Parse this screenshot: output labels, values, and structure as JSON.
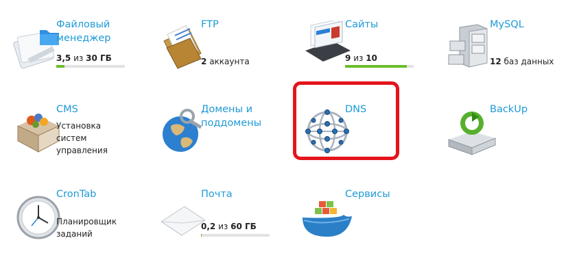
{
  "tiles": {
    "files": {
      "title_line1": "Файловый",
      "title_line2": "менеджер",
      "used": "3,5",
      "sep": "из",
      "total": "30 ГБ",
      "usage_fraction": 0.117,
      "icon": "file-manager-icon"
    },
    "ftp": {
      "title": "FTP",
      "count": "2",
      "count_label": "аккаунта",
      "icon": "ftp-folder-icon"
    },
    "sites": {
      "title": "Сайты",
      "used": "9",
      "sep": "из",
      "total": "10",
      "usage_fraction": 0.9,
      "icon": "websites-icon"
    },
    "mysql": {
      "title": "MySQL",
      "count": "12",
      "count_label": "баз данных",
      "icon": "database-cabinet-icon"
    },
    "cms": {
      "title": "CMS",
      "desc_line1": "Установка",
      "desc_line2": "систем",
      "desc_line3": "управления",
      "icon": "cms-box-icon"
    },
    "domains": {
      "title_line1": "Домены и",
      "title_line2": "поддомены",
      "icon": "globe-keys-icon"
    },
    "dns": {
      "title": "DNS",
      "icon": "dns-network-sphere-icon",
      "highlighted": true,
      "highlight_color": "#e5141b"
    },
    "backup": {
      "title": "BackUp",
      "icon": "backup-drive-icon"
    },
    "cron": {
      "title": "CronTab",
      "desc_line1": "Планировщик",
      "desc_line2": "заданий",
      "icon": "clock-icon"
    },
    "mail": {
      "title": "Почта",
      "used": "0,2",
      "sep": "из",
      "total": "60 ГБ",
      "usage_fraction": 0.004,
      "icon": "envelope-icon"
    },
    "services": {
      "title": "Сервисы",
      "icon": "docker-whale-icon"
    }
  },
  "colors": {
    "link": "#1e9ad6",
    "bar_fill": "#6cbd2a",
    "bar_track": "#e2e2e2"
  }
}
